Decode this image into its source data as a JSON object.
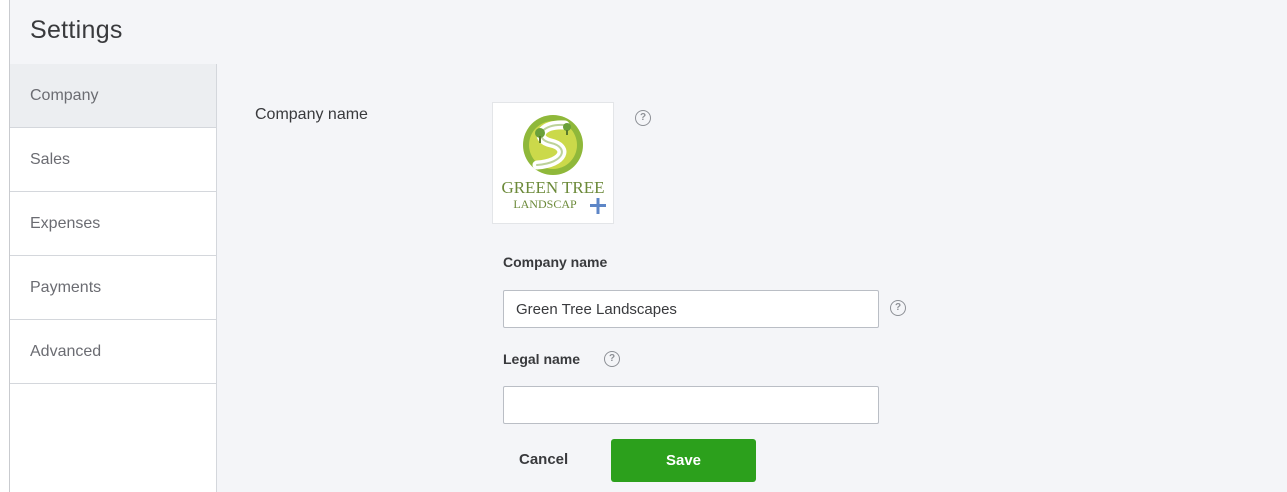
{
  "header": {
    "title": "Settings"
  },
  "sidebar": {
    "items": [
      {
        "label": "Company",
        "active": true
      },
      {
        "label": "Sales"
      },
      {
        "label": "Expenses"
      },
      {
        "label": "Payments"
      },
      {
        "label": "Advanced"
      }
    ]
  },
  "section": {
    "label": "Company name"
  },
  "logo": {
    "line1": "GREEN TREE",
    "line2": "LANDSCAP",
    "add_icon": "plus-icon",
    "colors": {
      "text": "#6c8a3a",
      "circle_outer": "#8fb83a",
      "circle_inner": "#cbd94a",
      "path": "#ffffff"
    }
  },
  "form": {
    "company_name_label": "Company name",
    "company_name_value": "Green Tree Landscapes",
    "legal_name_label": "Legal name",
    "legal_name_value": "",
    "help_icon": "question-circle-icon",
    "help_glyph": "?"
  },
  "actions": {
    "cancel_label": "Cancel",
    "save_label": "Save"
  },
  "colors": {
    "accent": "#2ca01c",
    "sidebar_active": "#eceef1",
    "background": "#f4f5f8"
  }
}
